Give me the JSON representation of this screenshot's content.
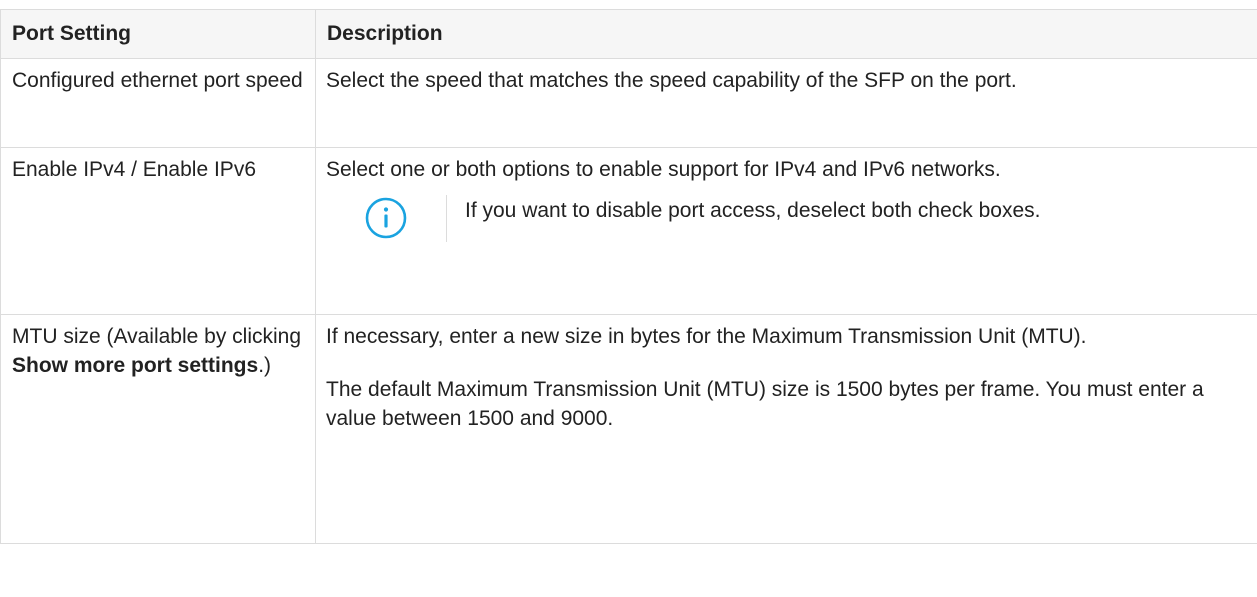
{
  "table": {
    "headers": [
      "Port Setting",
      "Description"
    ],
    "rows": [
      {
        "setting": "Configured ethernet port speed",
        "description": "Select the speed that matches the speed capability of the SFP on the port."
      },
      {
        "setting": "Enable IPv4 / Enable IPv6",
        "description": "Select one or both options to enable support for IPv4 and IPv6 networks.",
        "note": "If you want to disable port access, deselect both check boxes."
      },
      {
        "setting_parts": {
          "before": "MTU size (Available by clicking ",
          "bold": "Show more port settings",
          "after": ".)"
        },
        "description": "If necessary, enter a new size in bytes for the Maximum Transmission Unit (MTU).",
        "description_2": "The default Maximum Transmission Unit (MTU) size is 1500 bytes per frame. You must enter a value between 1500 and 9000."
      }
    ]
  },
  "icons": {
    "note_icon": "info-circle-icon",
    "note_icon_color": "#1aa3e0"
  }
}
